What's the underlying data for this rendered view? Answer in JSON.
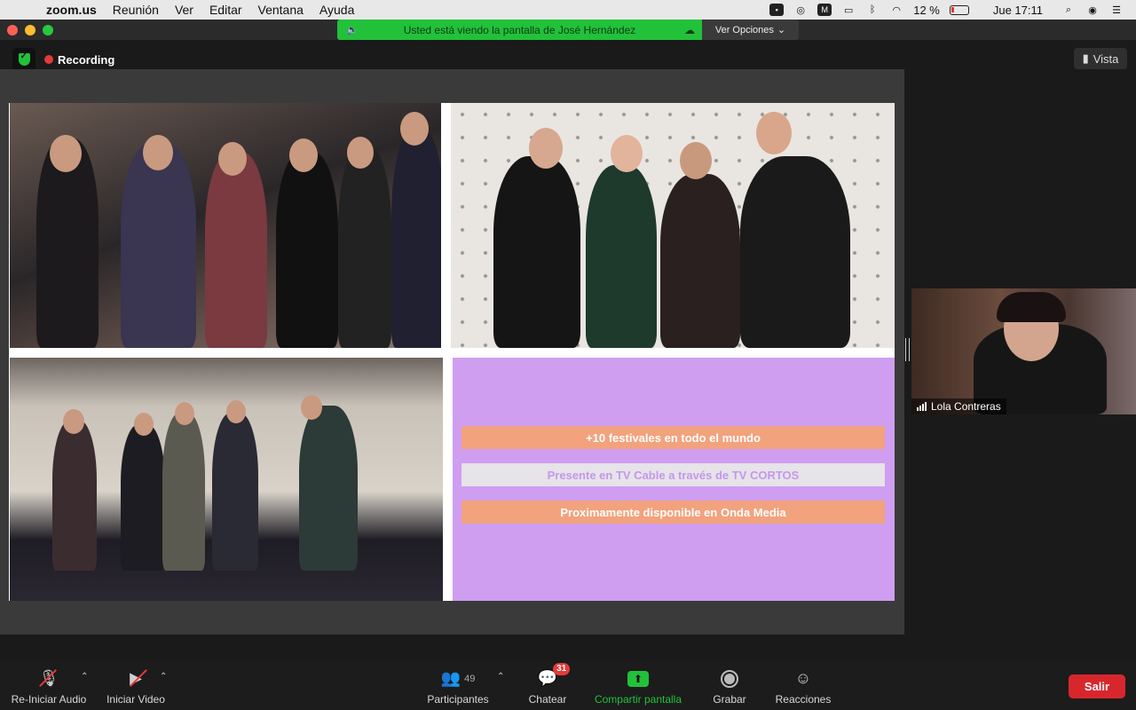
{
  "menubar": {
    "app_name": "zoom.us",
    "menus": [
      "Reunión",
      "Ver",
      "Editar",
      "Ventana",
      "Ayuda"
    ],
    "battery_pct": "12 %",
    "clock": "Jue 17:11"
  },
  "titlebar": {
    "share_banner": "Usted está viendo la pantalla de José Hernández",
    "view_options": "Ver Opciones"
  },
  "meeting": {
    "recording_label": "Recording",
    "view_button": "Vista",
    "slide": {
      "bullets": [
        "+10 festivales en todo el mundo",
        "Presente en TV Cable a través de TV CORTOS",
        "Proximamente disponible en Onda Media"
      ]
    },
    "participant_name": "Lola Contreras"
  },
  "toolbar": {
    "audio_label": "Re-Iniciar Audio",
    "video_label": "Iniciar Video",
    "participants_label": "Participantes",
    "participants_count": "49",
    "chat_label": "Chatear",
    "chat_badge": "31",
    "share_label": "Compartir pantalla",
    "record_label": "Grabar",
    "reactions_label": "Reacciones",
    "leave_label": "Salir"
  },
  "colors": {
    "green": "#22c13a",
    "red": "#d7272d",
    "purple_panel": "#cf9ef0",
    "orange_bar": "#f2a27d"
  }
}
